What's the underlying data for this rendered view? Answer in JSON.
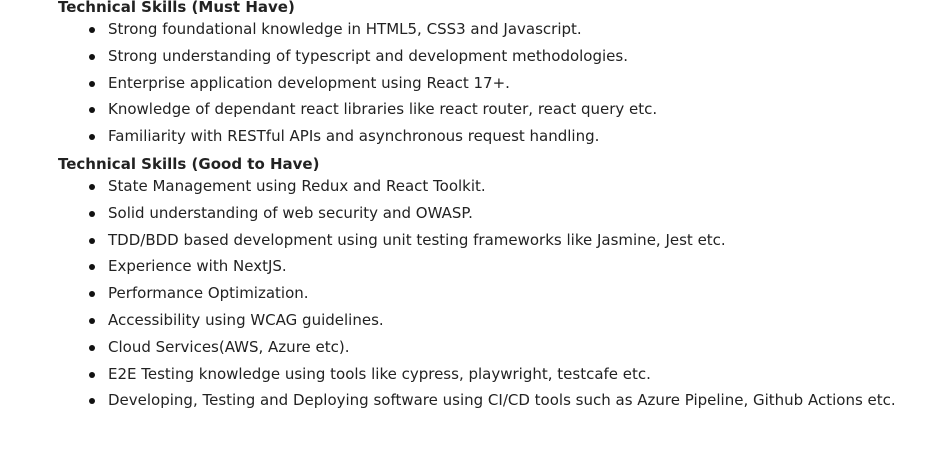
{
  "must_have": {
    "heading": "Technical Skills (Must Have)",
    "items": [
      "Strong foundational knowledge in HTML5, CSS3 and Javascript.",
      "Strong understanding of typescript and development methodologies.",
      "Enterprise application development using React 17+.",
      "Knowledge of dependant react libraries like react router, react query etc.",
      "Familiarity with RESTful APIs and asynchronous request handling."
    ]
  },
  "good_to_have": {
    "heading": "Technical Skills (Good to Have)",
    "items": [
      "State Management using Redux and React Toolkit.",
      "Solid understanding of web security and OWASP.",
      "TDD/BDD based development using unit testing frameworks like Jasmine, Jest etc.",
      "Experience with NextJS.",
      "Performance Optimization.",
      "Accessibility using WCAG guidelines.",
      "Cloud Services(AWS, Azure etc).",
      "E2E Testing knowledge using tools like cypress, playwright, testcafe etc.",
      "Developing, Testing and Deploying software using CI/CD tools such as Azure Pipeline, Github Actions etc."
    ]
  }
}
